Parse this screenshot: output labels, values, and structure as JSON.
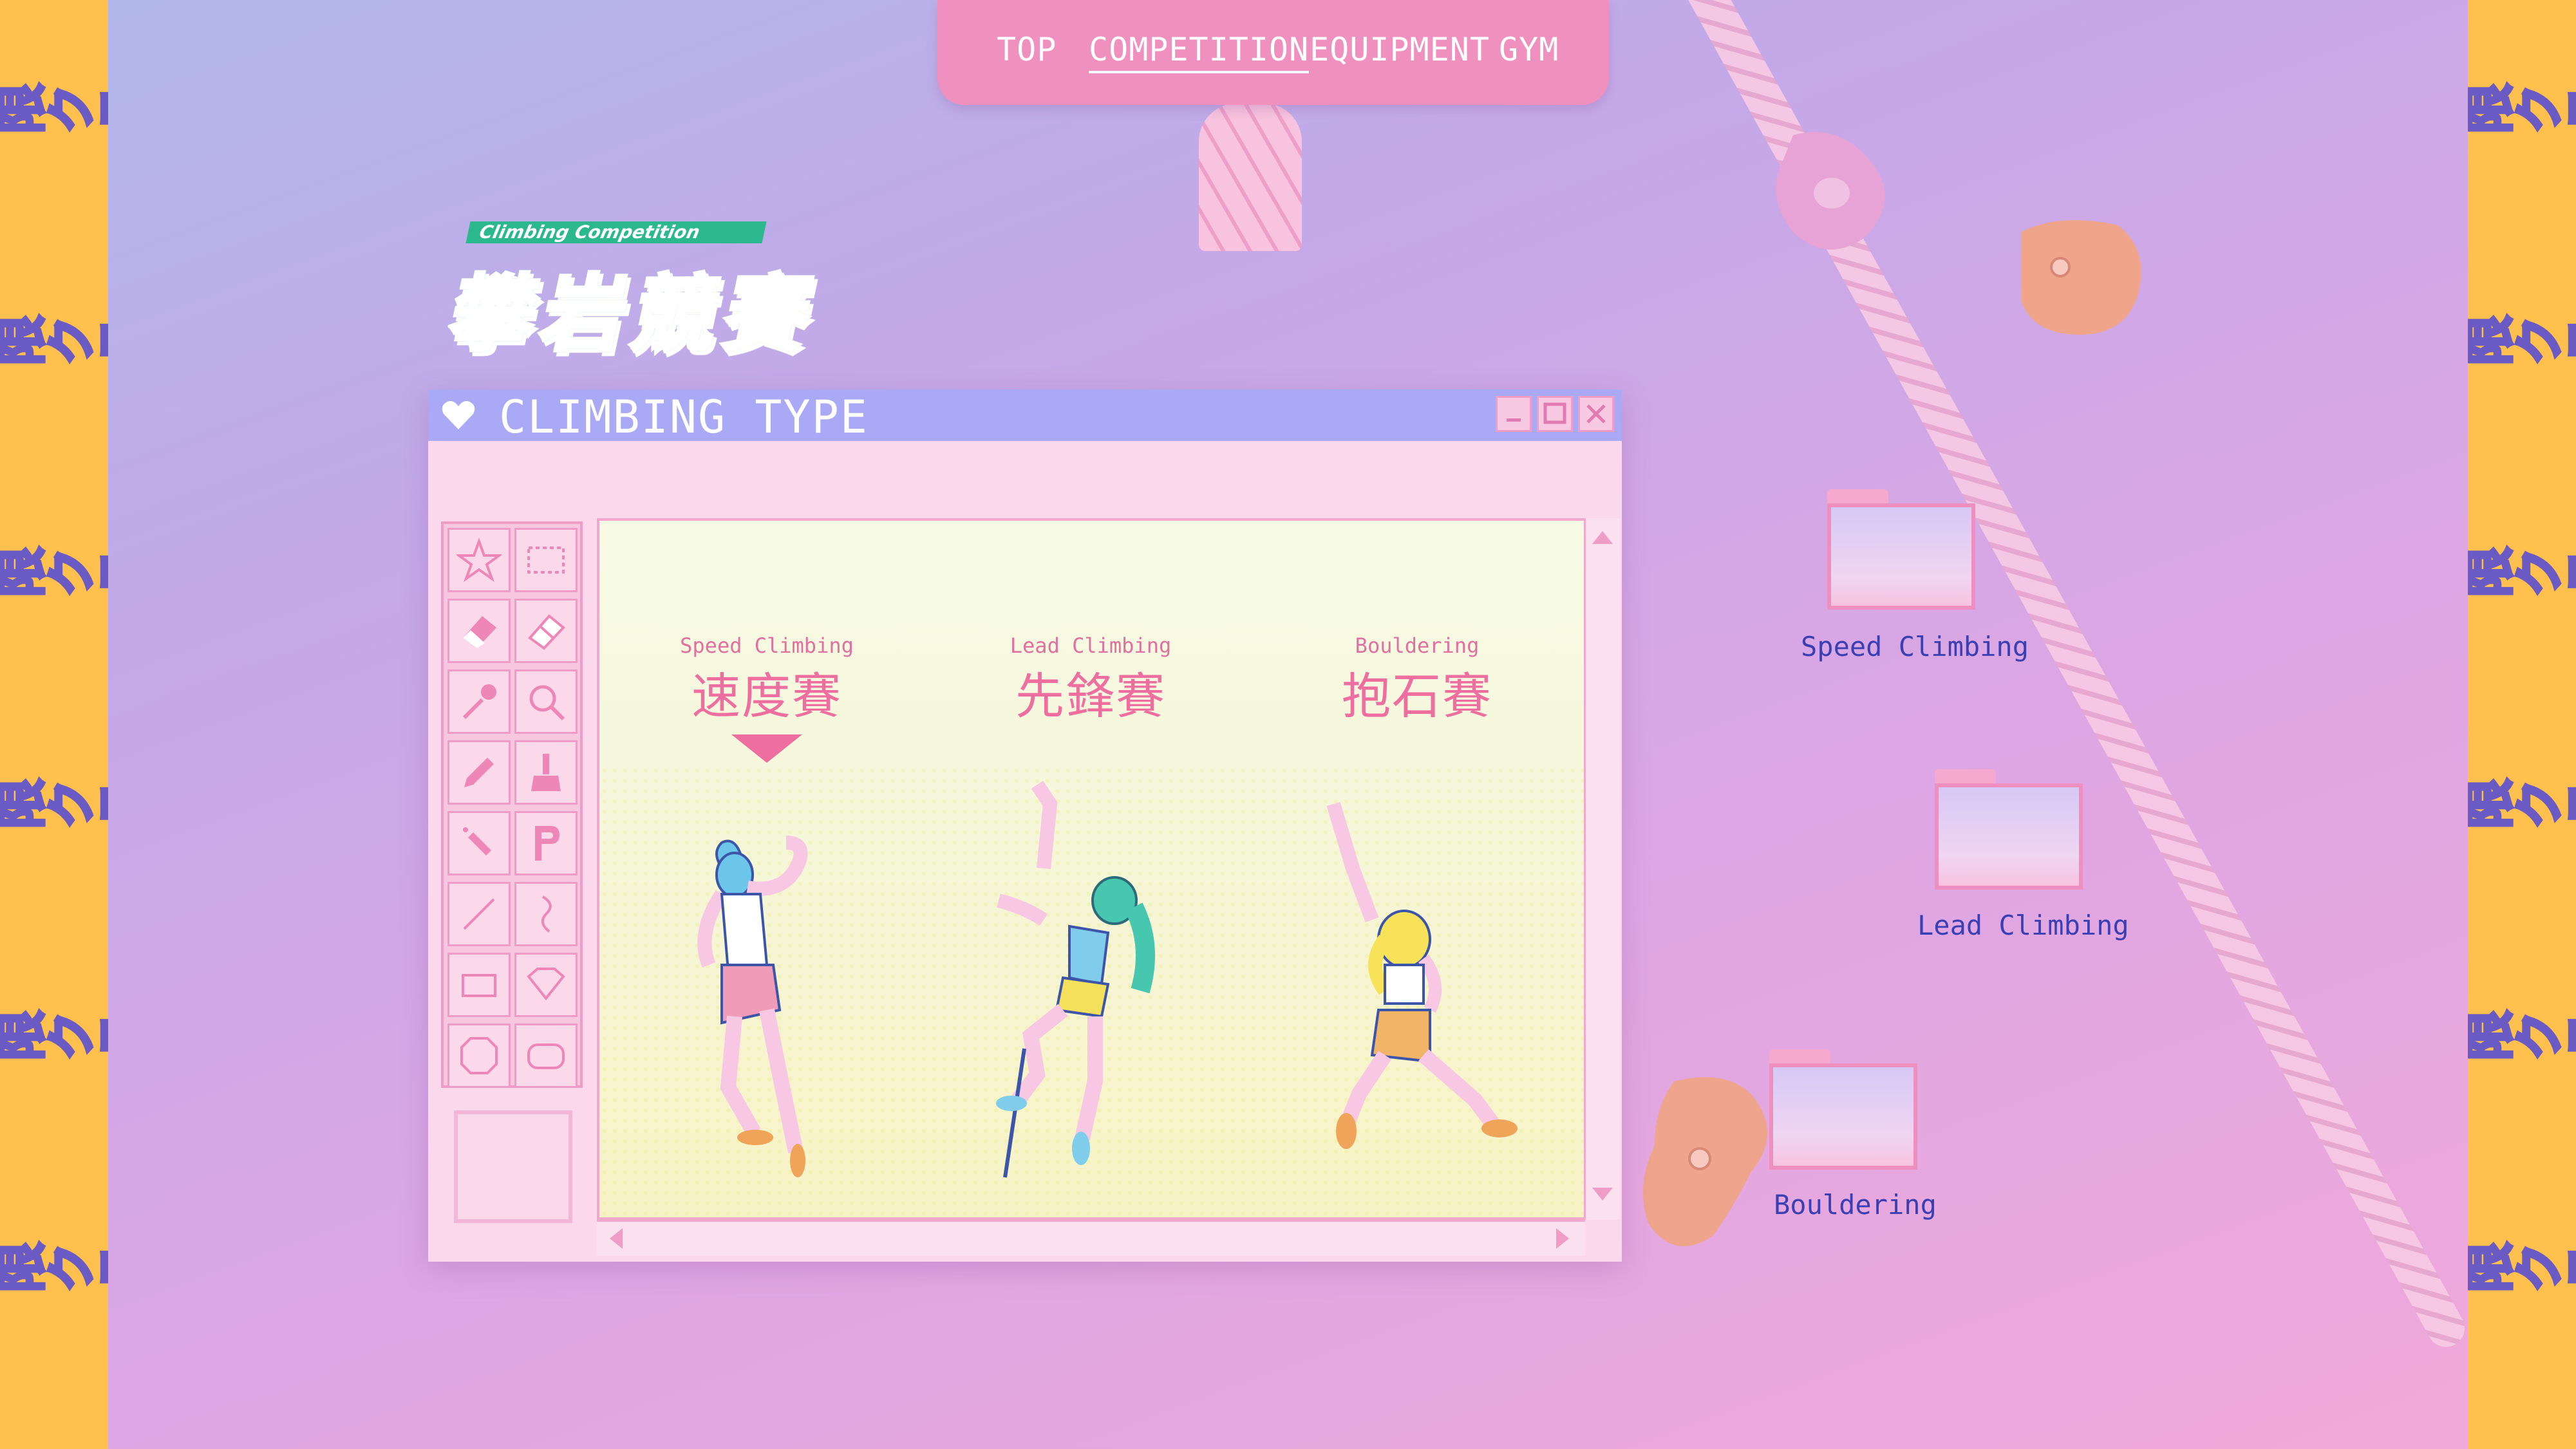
{
  "brand": {
    "side_text": "極限クライミング",
    "badge": "Climbing Competition",
    "title": "攀岩競賽"
  },
  "nav": {
    "items": [
      {
        "label": "TOP",
        "active": false
      },
      {
        "label": "COMPETITION",
        "active": true
      },
      {
        "label": "EQUIPMENT",
        "active": false
      },
      {
        "label": "GYM",
        "active": false
      }
    ]
  },
  "window": {
    "title": "CLIMBING TYPE",
    "icon": "heart-icon",
    "controls": [
      "minimize-icon",
      "maximize-icon",
      "close-icon"
    ],
    "tools": [
      "star-icon",
      "select-rect-icon",
      "eraser-icon",
      "color-eraser-icon",
      "eyedropper-icon",
      "magnifier-icon",
      "pencil-icon",
      "brush-icon",
      "airbrush-icon",
      "text-icon",
      "line-icon",
      "curve-icon",
      "rectangle-icon",
      "polygon-icon",
      "ellipse-icon",
      "rounded-rect-icon"
    ],
    "types": [
      {
        "en": "Speed Climbing",
        "zh": "速度賽",
        "selected": true
      },
      {
        "en": "Lead Climbing",
        "zh": "先鋒賽",
        "selected": false
      },
      {
        "en": "Bouldering",
        "zh": "抱石賽",
        "selected": false
      }
    ]
  },
  "desktop": {
    "folders": [
      {
        "label": "Speed Climbing"
      },
      {
        "label": "Lead Climbing"
      },
      {
        "label": "Bouldering"
      }
    ]
  },
  "colors": {
    "accent_pink": "#f090bf",
    "titlebar": "#a9a9f6",
    "side_band": "#ffc04d",
    "label_blue": "#3a3fb3",
    "logo_green": "#2bb88d"
  }
}
